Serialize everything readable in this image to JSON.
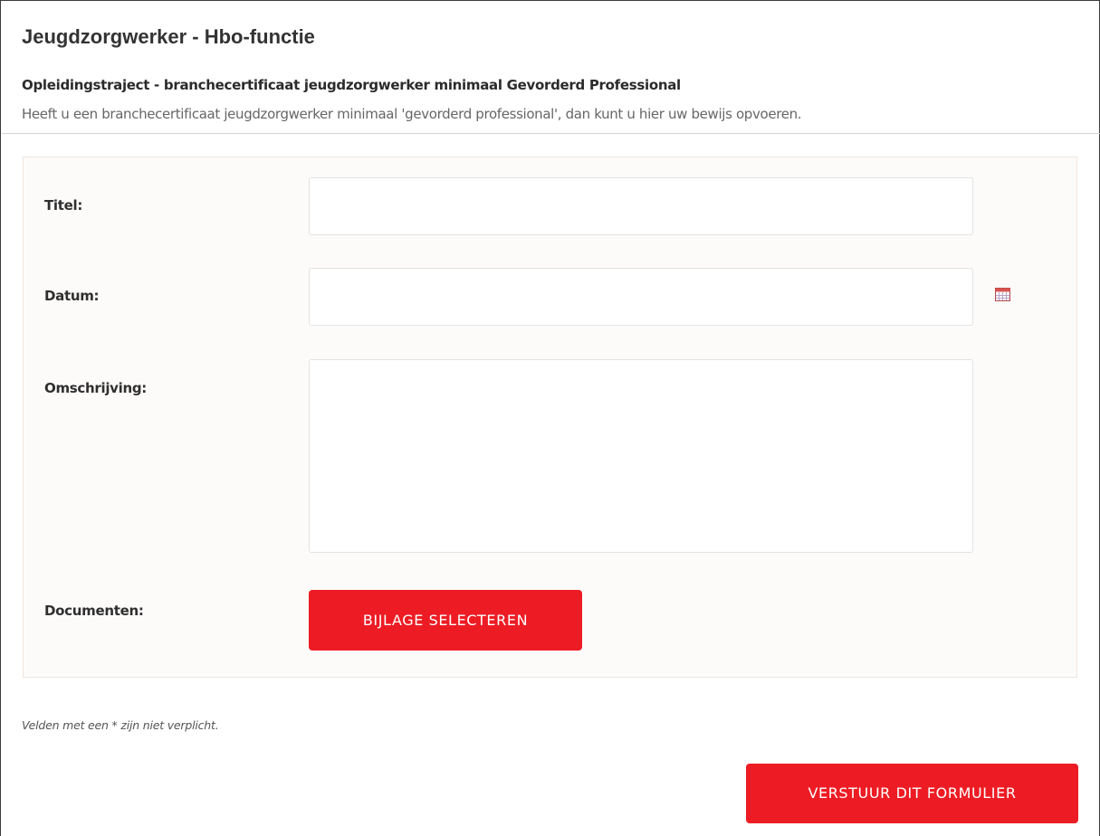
{
  "page": {
    "title": "Jeugdzorgwerker - Hbo-functie"
  },
  "section": {
    "title": "Opleidingstraject - branchecertificaat jeugdzorgwerker minimaal Gevorderd Professional",
    "description": "Heeft u een branchecertificaat jeugdzorgwerker minimaal 'gevorderd professional', dan kunt u hier uw bewijs opvoeren."
  },
  "form": {
    "title_label": "Titel:",
    "title_value": "",
    "date_label": "Datum:",
    "date_value": "",
    "date_icon": "calendar-icon",
    "description_label": "Omschrijving:",
    "description_value": "",
    "documents_label": "Documenten:",
    "attach_button": "BIJLAGE SELECTEREN"
  },
  "footnote": "Velden met een * zijn niet verplicht.",
  "submit_button": "VERSTUUR DIT FORMULIER",
  "colors": {
    "accent": "#ed1c24",
    "panel_background": "#fdfbfa",
    "panel_border": "#eee6df"
  }
}
